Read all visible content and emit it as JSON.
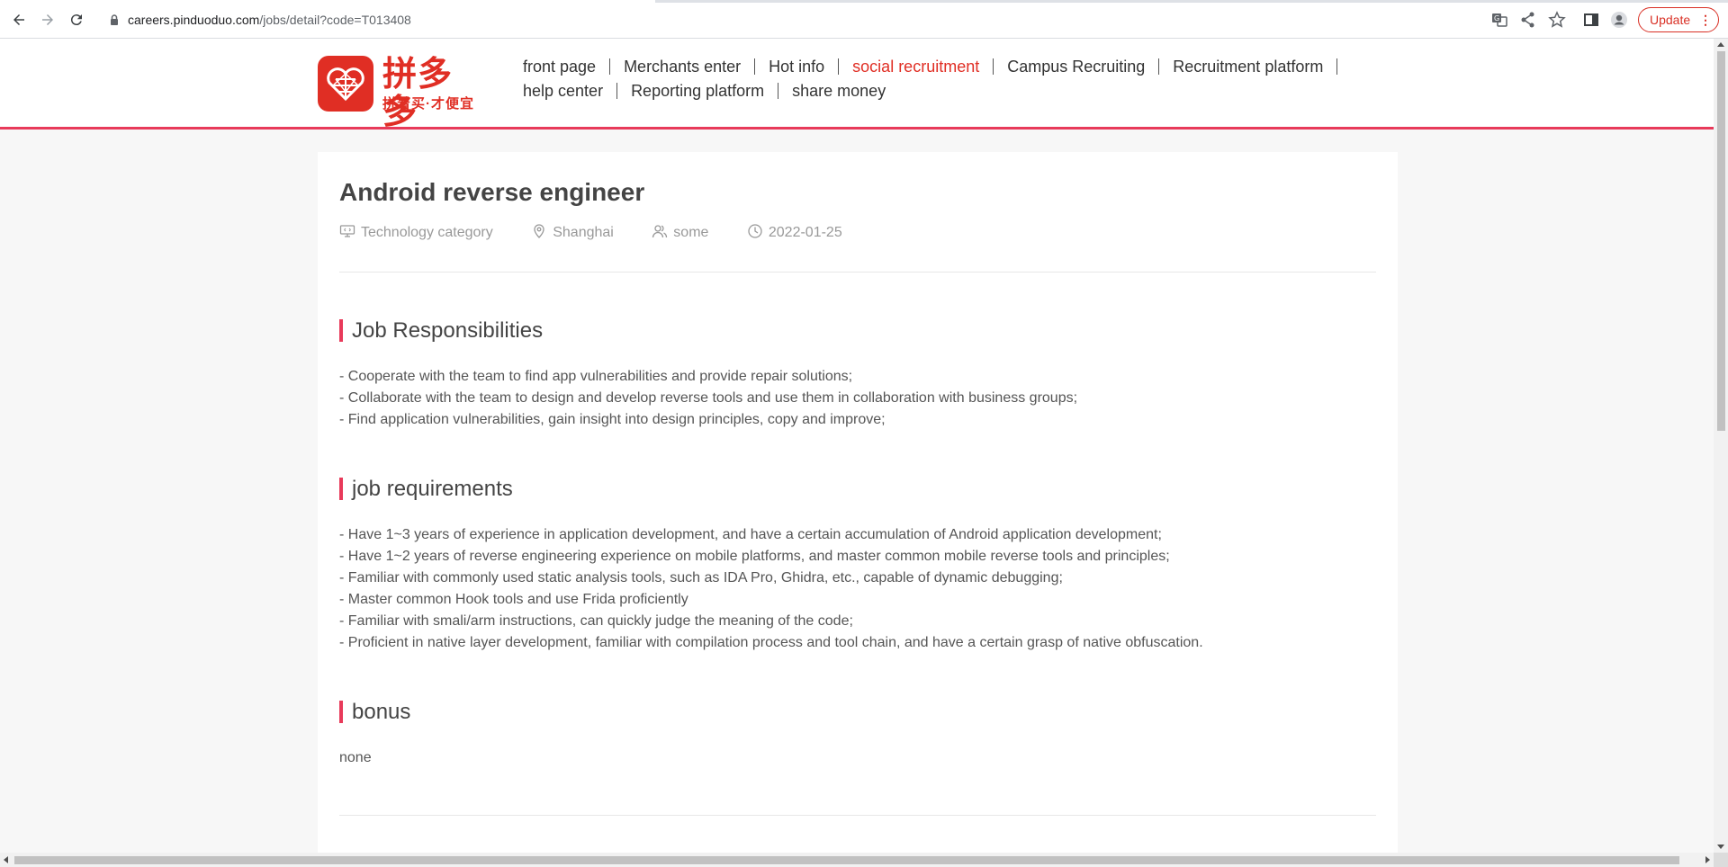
{
  "browser": {
    "url_host": "careers.pinduoduo.com",
    "url_path": "/jobs/detail?code=T013408",
    "update_label": "Update"
  },
  "site": {
    "brand": "拼多多",
    "slogan": "拼着买·才便宜",
    "nav": {
      "row1": [
        "front page",
        "Merchants enter",
        "Hot info",
        "social recruitment",
        "Campus Recruiting",
        "Recruitment platform"
      ],
      "row2": [
        "help center",
        "Reporting platform",
        "share money"
      ],
      "active": "social recruitment"
    }
  },
  "job": {
    "title": "Android reverse engineer",
    "category": "Technology category",
    "location": "Shanghai",
    "headcount": "some",
    "date": "2022-01-25"
  },
  "sections": {
    "responsibilities": {
      "title": "Job Responsibilities",
      "lines": [
        "- Cooperate with the team to find app vulnerabilities and provide repair solutions;",
        "- Collaborate with the team to design and develop reverse tools and use them in collaboration with business groups;",
        "- Find application vulnerabilities, gain insight into design principles, copy and improve;"
      ]
    },
    "requirements": {
      "title": "job requirements",
      "lines": [
        "- Have 1~3 years of experience in application development, and have a certain accumulation of Android application development;",
        "- Have 1~2 years of reverse engineering experience on mobile platforms, and master common mobile reverse tools and principles;",
        "- Familiar with commonly used static analysis tools, such as IDA Pro, Ghidra, etc., capable of dynamic debugging;",
        "- Master common Hook tools and use Frida proficiently",
        "- Familiar with smali/arm instructions, can quickly judge the meaning of the code;",
        "- Proficient in native layer development, familiar with compilation process and tool chain, and have a certain grasp of native obfuscation."
      ]
    },
    "bonus": {
      "title": "bonus",
      "lines": [
        "none"
      ]
    }
  },
  "colors": {
    "brand_red": "#e02e24",
    "accent_pink": "#e83a5a"
  }
}
